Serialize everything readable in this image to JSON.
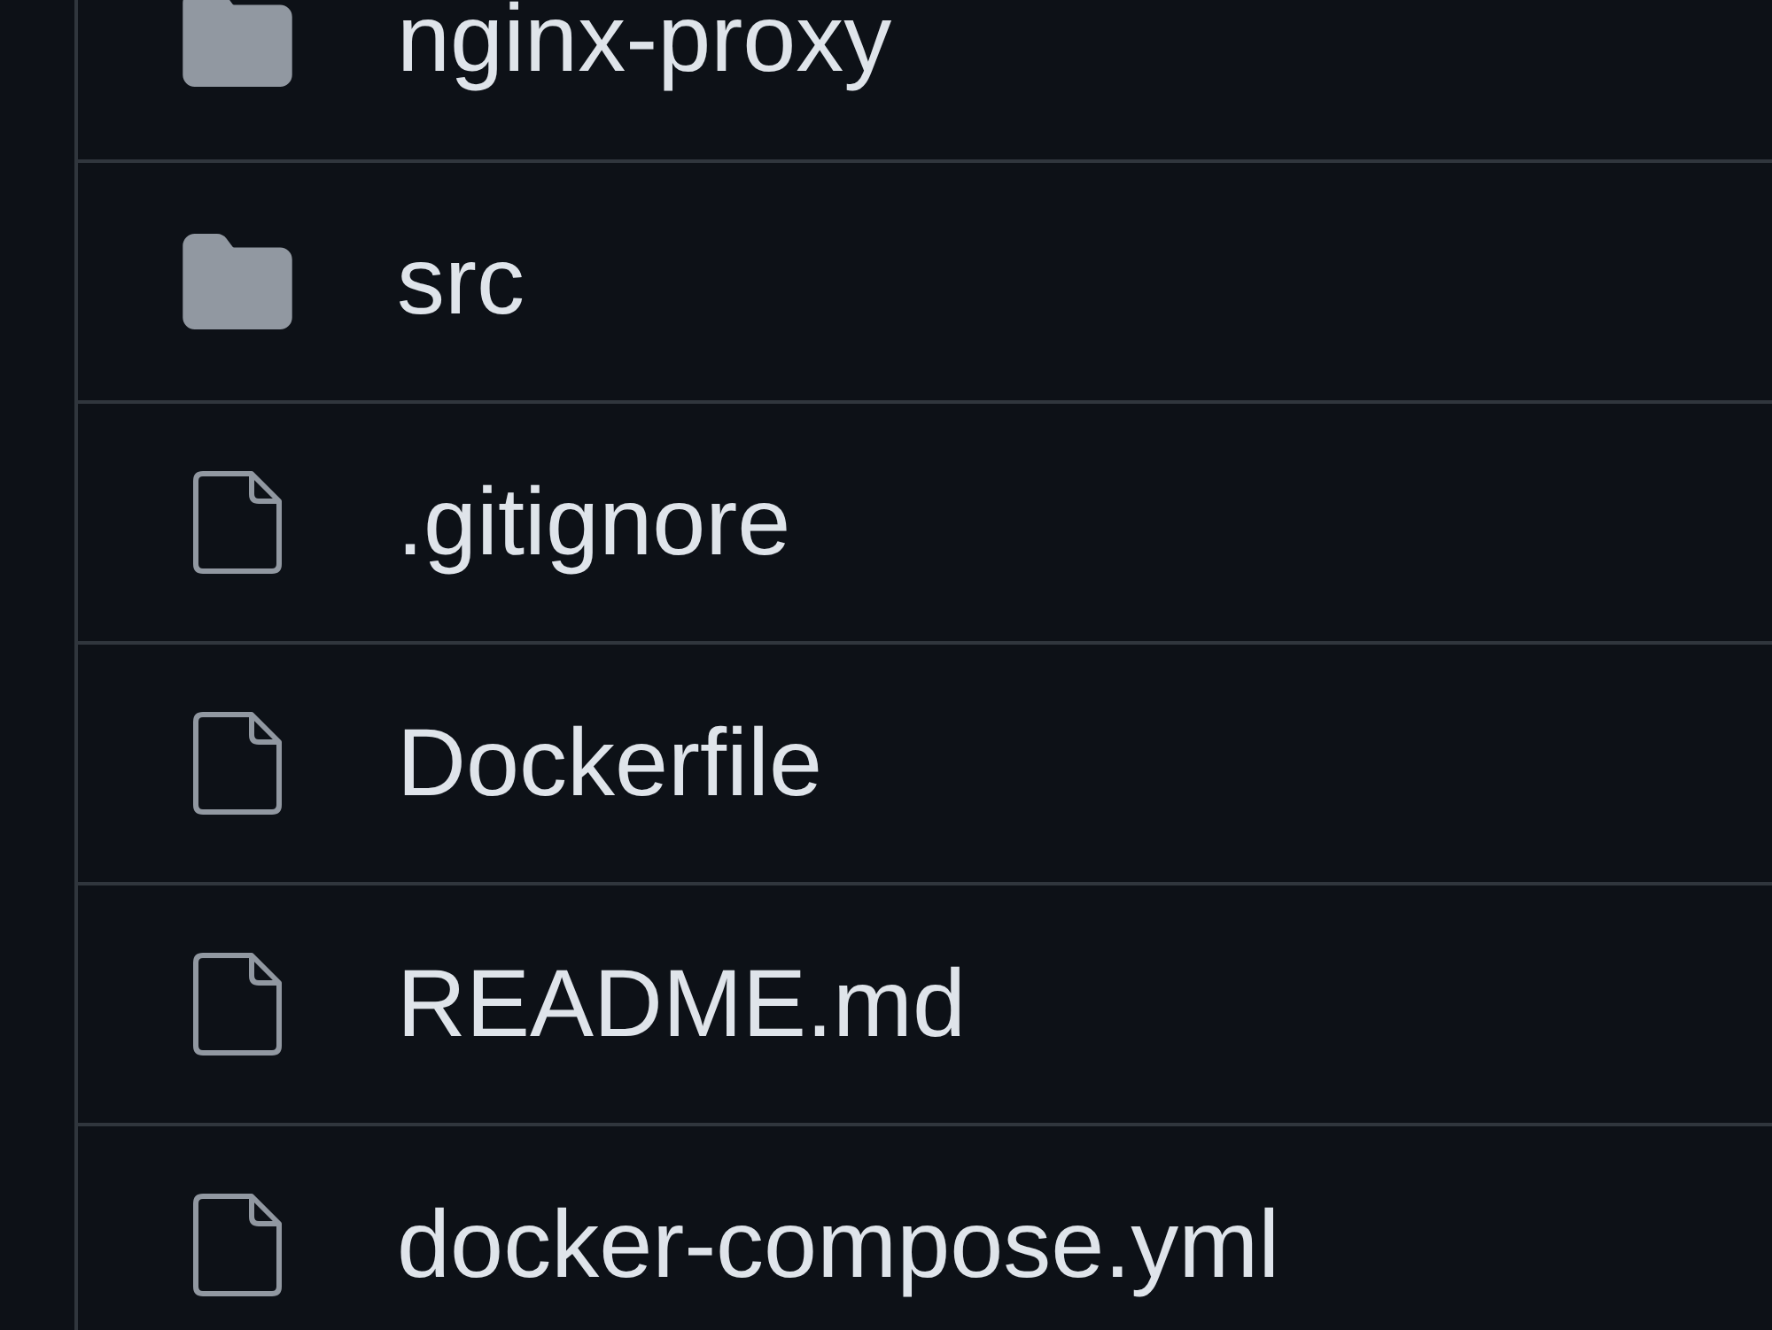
{
  "file_list": [
    {
      "kind": "folder",
      "name": "nginx-proxy"
    },
    {
      "kind": "folder",
      "name": "src"
    },
    {
      "kind": "file",
      "name": ".gitignore"
    },
    {
      "kind": "file",
      "name": "Dockerfile"
    },
    {
      "kind": "file",
      "name": "README.md"
    },
    {
      "kind": "file",
      "name": "docker-compose.yml"
    }
  ]
}
